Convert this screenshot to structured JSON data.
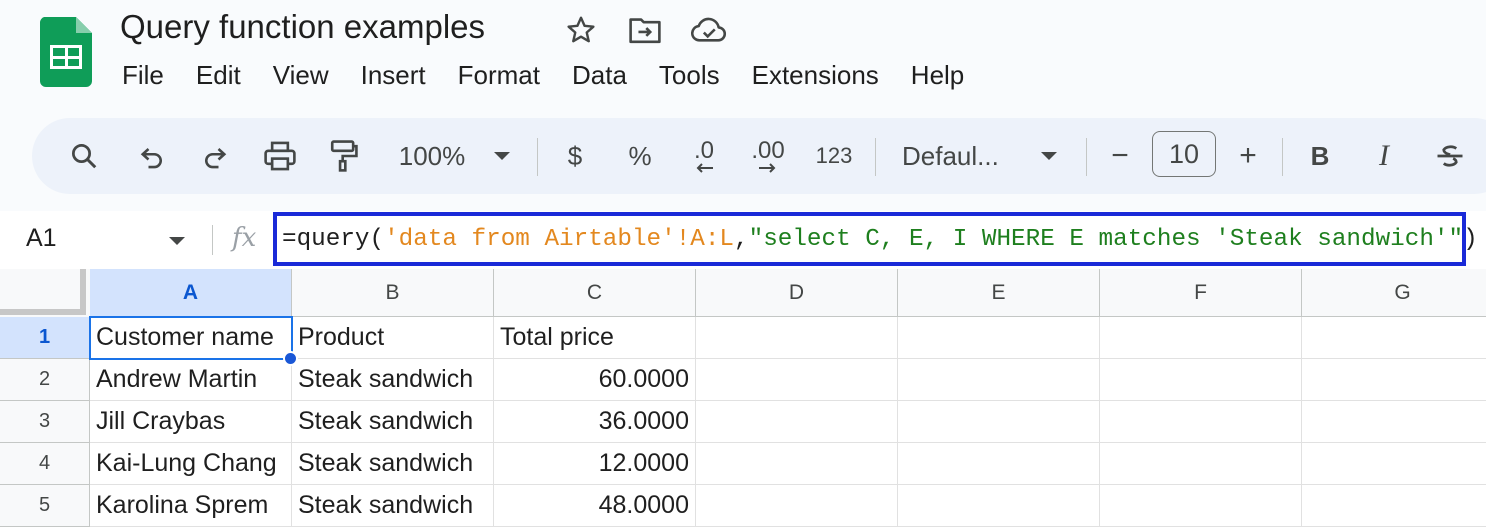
{
  "app": {
    "title": "Query function examples",
    "brand_color": "#0f9d58",
    "title_icons": [
      "star-icon",
      "move-to-folder-icon",
      "cloud-saved-icon"
    ]
  },
  "menu": [
    "File",
    "Edit",
    "View",
    "Insert",
    "Format",
    "Data",
    "Tools",
    "Extensions",
    "Help"
  ],
  "toolbar": {
    "zoom": "100%",
    "currency": "$",
    "percent": "%",
    "decrease_decimal": ".0",
    "increase_decimal": ".00",
    "number_format": "123",
    "font": "Defaul...",
    "font_size": "10",
    "minus": "−",
    "plus": "+",
    "bold": "B",
    "italic": "I",
    "icons": [
      "search-icon",
      "undo-icon",
      "redo-icon",
      "print-icon",
      "paint-format-icon",
      "caret-down-icon",
      "strikethrough-icon"
    ]
  },
  "formula_bar": {
    "cell_ref": "A1",
    "fx": "fx",
    "formula_parts": [
      "=query(",
      "'data from Airtable'!A:L",
      ",",
      "\"select C, E, I WHERE E matches 'Steak sandwich'\"",
      ")"
    ],
    "highlight_color": "#1a2ad8"
  },
  "grid": {
    "columns": [
      "A",
      "B",
      "C",
      "D",
      "E",
      "F",
      "G"
    ],
    "selected_column": "A",
    "rows": [
      "1",
      "2",
      "3",
      "4",
      "5"
    ],
    "selected_row": "1",
    "selected_cell": "A1",
    "cells": [
      [
        "Customer name",
        "Product",
        "Total price"
      ],
      [
        "Andrew Martin",
        "Steak sandwich",
        "60.0000"
      ],
      [
        "Jill Craybas",
        "Steak sandwich",
        "36.0000"
      ],
      [
        "Kai-Lung Chang",
        "Steak sandwich",
        "12.0000"
      ],
      [
        "Karolina Sprem",
        "Steak sandwich",
        "48.0000"
      ]
    ]
  }
}
